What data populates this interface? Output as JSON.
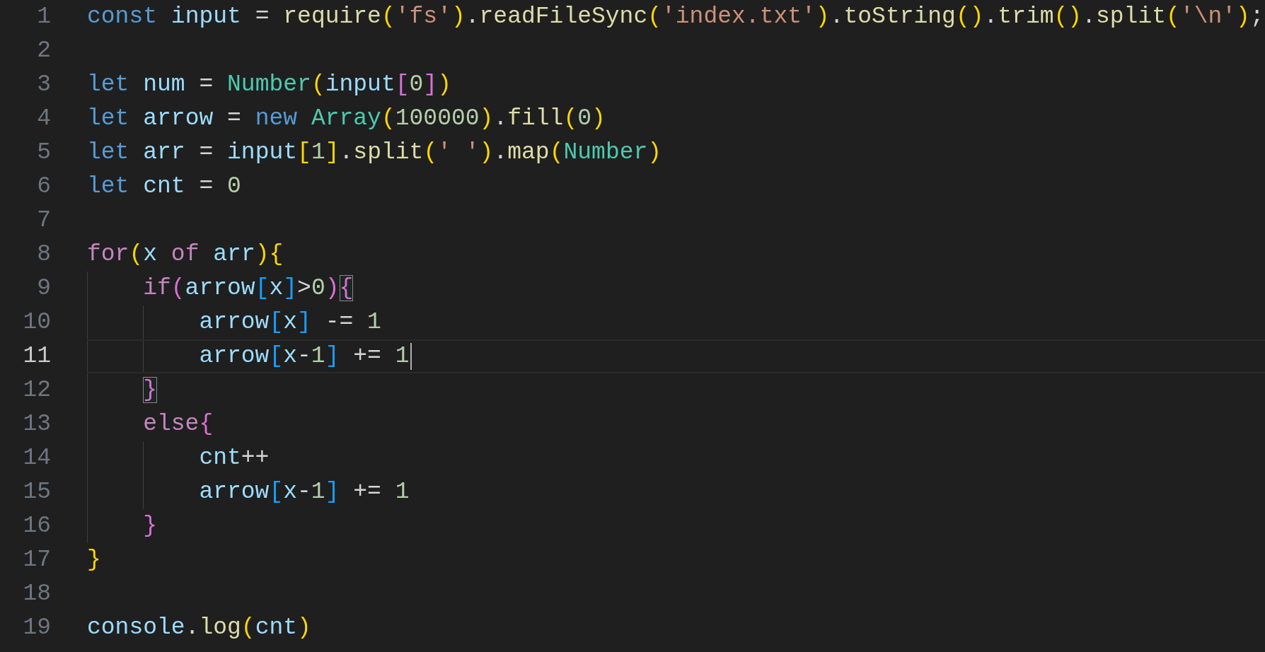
{
  "editor": {
    "lines": [
      {
        "number": "1",
        "current": false,
        "tokens": [
          {
            "kind": "keyword",
            "text": "const"
          },
          {
            "kind": "variable",
            "text": " input"
          },
          {
            "kind": "plain",
            "text": " = "
          },
          {
            "kind": "function",
            "text": "require"
          },
          {
            "kind": "bracket1",
            "text": "("
          },
          {
            "kind": "string",
            "text": "'fs'"
          },
          {
            "kind": "bracket1",
            "text": ")"
          },
          {
            "kind": "plain",
            "text": "."
          },
          {
            "kind": "function",
            "text": "readFileSync"
          },
          {
            "kind": "bracket1",
            "text": "("
          },
          {
            "kind": "string",
            "text": "'index.txt'"
          },
          {
            "kind": "bracket1",
            "text": ")"
          },
          {
            "kind": "plain",
            "text": "."
          },
          {
            "kind": "function",
            "text": "toString"
          },
          {
            "kind": "bracket1",
            "text": "()"
          },
          {
            "kind": "plain",
            "text": "."
          },
          {
            "kind": "function",
            "text": "trim"
          },
          {
            "kind": "bracket1",
            "text": "()"
          },
          {
            "kind": "plain",
            "text": "."
          },
          {
            "kind": "function",
            "text": "split"
          },
          {
            "kind": "bracket1",
            "text": "("
          },
          {
            "kind": "string",
            "text": "'\\n'"
          },
          {
            "kind": "bracket1",
            "text": ")"
          },
          {
            "kind": "plain",
            "text": ";"
          }
        ]
      },
      {
        "number": "2",
        "current": false
      },
      {
        "number": "3",
        "current": false,
        "tokens": [
          {
            "kind": "keyword",
            "text": "let"
          },
          {
            "kind": "variable",
            "text": " num"
          },
          {
            "kind": "plain",
            "text": " = "
          },
          {
            "kind": "class",
            "text": "Number"
          },
          {
            "kind": "bracket1",
            "text": "("
          },
          {
            "kind": "variable",
            "text": "input"
          },
          {
            "kind": "bracket2",
            "text": "["
          },
          {
            "kind": "number",
            "text": "0"
          },
          {
            "kind": "bracket2",
            "text": "]"
          },
          {
            "kind": "bracket1",
            "text": ")"
          }
        ]
      },
      {
        "number": "4",
        "current": false,
        "tokens": [
          {
            "kind": "keyword",
            "text": "let"
          },
          {
            "kind": "variable",
            "text": " arrow"
          },
          {
            "kind": "plain",
            "text": " = "
          },
          {
            "kind": "keyword",
            "text": "new"
          },
          {
            "kind": "class",
            "text": " Array"
          },
          {
            "kind": "bracket1",
            "text": "("
          },
          {
            "kind": "number",
            "text": "100000"
          },
          {
            "kind": "bracket1",
            "text": ")"
          },
          {
            "kind": "plain",
            "text": "."
          },
          {
            "kind": "function",
            "text": "fill"
          },
          {
            "kind": "bracket1",
            "text": "("
          },
          {
            "kind": "number",
            "text": "0"
          },
          {
            "kind": "bracket1",
            "text": ")"
          }
        ]
      },
      {
        "number": "5",
        "current": false,
        "tokens": [
          {
            "kind": "keyword",
            "text": "let"
          },
          {
            "kind": "variable",
            "text": " arr"
          },
          {
            "kind": "plain",
            "text": " = "
          },
          {
            "kind": "variable",
            "text": "input"
          },
          {
            "kind": "bracket1",
            "text": "["
          },
          {
            "kind": "number",
            "text": "1"
          },
          {
            "kind": "bracket1",
            "text": "]"
          },
          {
            "kind": "plain",
            "text": "."
          },
          {
            "kind": "function",
            "text": "split"
          },
          {
            "kind": "bracket1",
            "text": "("
          },
          {
            "kind": "string",
            "text": "' '"
          },
          {
            "kind": "bracket1",
            "text": ")"
          },
          {
            "kind": "plain",
            "text": "."
          },
          {
            "kind": "function",
            "text": "map"
          },
          {
            "kind": "bracket1",
            "text": "("
          },
          {
            "kind": "class",
            "text": "Number"
          },
          {
            "kind": "bracket1",
            "text": ")"
          }
        ]
      },
      {
        "number": "6",
        "current": false,
        "tokens": [
          {
            "kind": "keyword",
            "text": "let"
          },
          {
            "kind": "variable",
            "text": " cnt"
          },
          {
            "kind": "plain",
            "text": " = "
          },
          {
            "kind": "number",
            "text": "0"
          }
        ]
      },
      {
        "number": "7",
        "current": false
      },
      {
        "number": "8",
        "current": false,
        "tokens": [
          {
            "kind": "control",
            "text": "for"
          },
          {
            "kind": "bracket1",
            "text": "("
          },
          {
            "kind": "variable",
            "text": "x"
          },
          {
            "kind": "control",
            "text": " of"
          },
          {
            "kind": "variable",
            "text": " arr"
          },
          {
            "kind": "bracket1",
            "text": ")"
          },
          {
            "kind": "bracket1",
            "text": "{"
          }
        ],
        "children": [
          {
            "number": "9",
            "current": false,
            "tokens": [
              {
                "kind": "control",
                "text": "if"
              },
              {
                "kind": "bracket2",
                "text": "("
              },
              {
                "kind": "variable",
                "text": "arrow"
              },
              {
                "kind": "bracket3",
                "text": "["
              },
              {
                "kind": "variable",
                "text": "x"
              },
              {
                "kind": "bracket3",
                "text": "]"
              },
              {
                "kind": "plain",
                "text": ">"
              },
              {
                "kind": "number",
                "text": "0"
              },
              {
                "kind": "bracket2",
                "text": ")"
              },
              {
                "kind": "bracket2",
                "text": "{",
                "match": true
              }
            ],
            "children": [
              {
                "number": "10",
                "current": false,
                "tokens": [
                  {
                    "kind": "variable",
                    "text": "arrow"
                  },
                  {
                    "kind": "bracket3",
                    "text": "["
                  },
                  {
                    "kind": "variable",
                    "text": "x"
                  },
                  {
                    "kind": "bracket3",
                    "text": "]"
                  },
                  {
                    "kind": "plain",
                    "text": " -= "
                  },
                  {
                    "kind": "number",
                    "text": "1"
                  }
                ]
              },
              {
                "number": "11",
                "current": true,
                "tokens": [
                  {
                    "kind": "variable",
                    "text": "arrow"
                  },
                  {
                    "kind": "bracket3",
                    "text": "["
                  },
                  {
                    "kind": "variable",
                    "text": "x"
                  },
                  {
                    "kind": "plain",
                    "text": "-"
                  },
                  {
                    "kind": "number",
                    "text": "1"
                  },
                  {
                    "kind": "bracket3",
                    "text": "]"
                  },
                  {
                    "kind": "plain",
                    "text": " += "
                  },
                  {
                    "kind": "number",
                    "text": "1"
                  }
                ]
              }
            ]
          },
          {
            "number": "12",
            "current": false,
            "tokens": [
              {
                "kind": "bracket2",
                "text": "}",
                "match": true
              }
            ]
          },
          {
            "number": "13",
            "current": false,
            "tokens": [
              {
                "kind": "control",
                "text": "else"
              },
              {
                "kind": "bracket2",
                "text": "{"
              }
            ],
            "children": [
              {
                "number": "14",
                "current": false,
                "tokens": [
                  {
                    "kind": "variable",
                    "text": "cnt"
                  },
                  {
                    "kind": "plain",
                    "text": "++"
                  }
                ]
              },
              {
                "number": "15",
                "current": false,
                "tokens": [
                  {
                    "kind": "variable",
                    "text": "arrow"
                  },
                  {
                    "kind": "bracket3",
                    "text": "["
                  },
                  {
                    "kind": "variable",
                    "text": "x"
                  },
                  {
                    "kind": "plain",
                    "text": "-"
                  },
                  {
                    "kind": "number",
                    "text": "1"
                  },
                  {
                    "kind": "bracket3",
                    "text": "]"
                  },
                  {
                    "kind": "plain",
                    "text": " += "
                  },
                  {
                    "kind": "number",
                    "text": "1"
                  }
                ]
              }
            ]
          },
          {
            "number": "16",
            "current": false,
            "tokens": [
              {
                "kind": "bracket2",
                "text": "}"
              }
            ]
          }
        ]
      },
      {
        "number": "17",
        "current": false,
        "tokens": [
          {
            "kind": "bracket1",
            "text": "}"
          }
        ]
      },
      {
        "number": "18",
        "current": false
      },
      {
        "number": "19",
        "current": false,
        "tokens": [
          {
            "kind": "variable",
            "text": "console"
          },
          {
            "kind": "plain",
            "text": "."
          },
          {
            "kind": "function",
            "text": "log"
          },
          {
            "kind": "bracket1",
            "text": "("
          },
          {
            "kind": "variable",
            "text": "cnt"
          },
          {
            "kind": "bracket1",
            "text": ")"
          }
        ]
      }
    ]
  }
}
